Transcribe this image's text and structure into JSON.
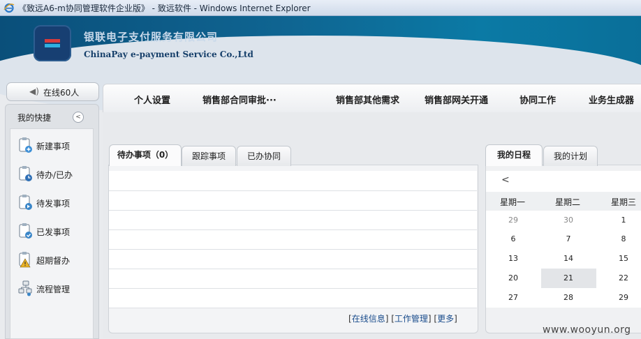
{
  "window": {
    "title": "《致远A6-m协同管理软件企业版》 - 致远软件 - Windows Internet Explorer"
  },
  "header": {
    "company_cn": "银联电子支付服务有限公司",
    "company_en": "ChinaPay e-payment Service Co.,Ltd"
  },
  "online": {
    "label": "在线60人"
  },
  "quick": {
    "title": "我的快捷",
    "items": [
      {
        "label": "新建事项",
        "icon": "new-item-icon"
      },
      {
        "label": "待办/已办",
        "icon": "clock-icon"
      },
      {
        "label": "待发事项",
        "icon": "send-pending-icon"
      },
      {
        "label": "已发事项",
        "icon": "check-icon"
      },
      {
        "label": "超期督办",
        "icon": "warning-icon"
      },
      {
        "label": "流程管理",
        "icon": "flow-icon"
      }
    ]
  },
  "nav": {
    "items": [
      "个人设置",
      "销售部合同审批···",
      "销售部其他需求",
      "销售部网关开通",
      "协同工作",
      "业务生成器"
    ]
  },
  "todo": {
    "tabs": [
      "待办事项（0）",
      "跟踪事项",
      "已办协同"
    ],
    "links": {
      "online_info": "在线信息",
      "work_manage": "工作管理",
      "more": "更多"
    }
  },
  "calendar": {
    "tabs": [
      "我的日程",
      "我的计划"
    ],
    "prev": "<",
    "weekdays": [
      "星期一",
      "星期二",
      "星期三"
    ],
    "weeks": [
      [
        "29",
        "30",
        "1"
      ],
      [
        "6",
        "7",
        "8"
      ],
      [
        "13",
        "14",
        "15"
      ],
      [
        "20",
        "21",
        "22"
      ],
      [
        "27",
        "28",
        "29"
      ]
    ],
    "highlight": "21"
  },
  "watermark": "www.wooyun.org",
  "colors": {
    "banner": "#0f6592",
    "link": "#1a4c8c"
  }
}
